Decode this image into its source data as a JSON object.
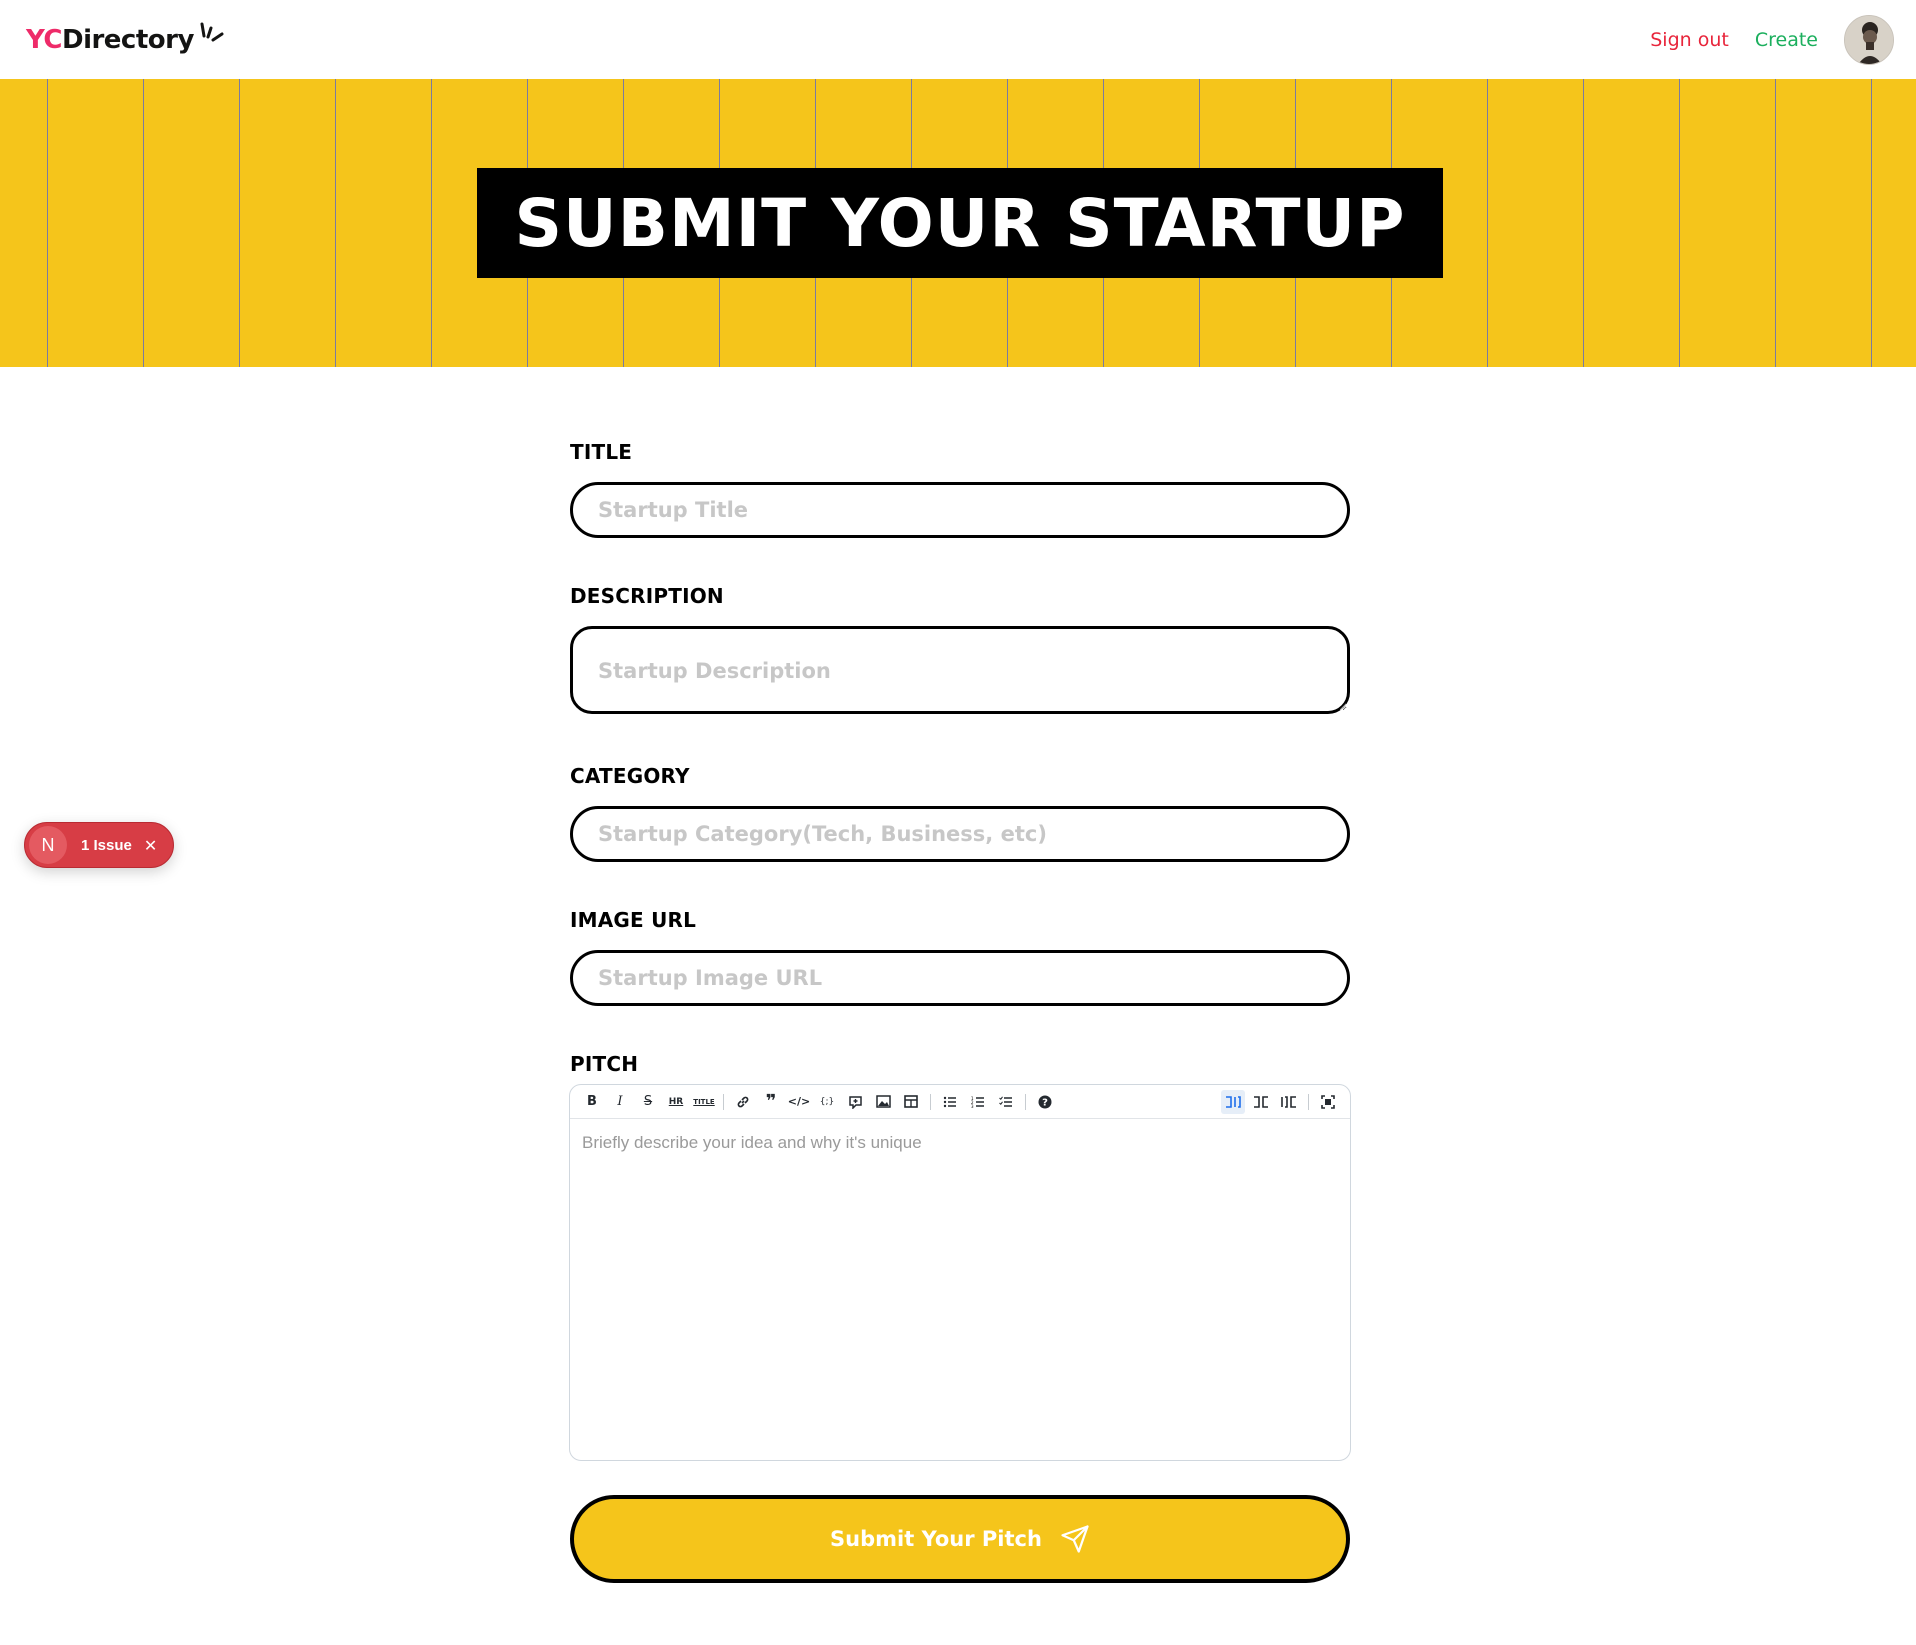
{
  "nav": {
    "logo_prefix": "YC",
    "logo_suffix": "Directory",
    "signout_label": "Sign out",
    "create_label": "Create"
  },
  "hero": {
    "title": "SUBMIT YOUR STARTUP"
  },
  "form": {
    "title": {
      "label": "Title",
      "placeholder": "Startup Title",
      "value": ""
    },
    "description": {
      "label": "Description",
      "placeholder": "Startup Description",
      "value": ""
    },
    "category": {
      "label": "Category",
      "placeholder": "Startup Category(Tech, Business, etc)",
      "value": ""
    },
    "image_url": {
      "label": "Image URL",
      "placeholder": "Startup Image URL",
      "value": ""
    },
    "pitch": {
      "label": "Pitch",
      "placeholder": "Briefly describe your idea and why it's unique",
      "toolbar": {
        "bold": "B",
        "italic": "I",
        "strike": "S",
        "hr": "HR",
        "title": "TITLE",
        "link": "🔗",
        "quote": "❞",
        "code": "</>",
        "codeblock": "{;}",
        "comment": "💬",
        "image": "🖼",
        "table": "▦",
        "ul": "☰",
        "ol": "☷",
        "checklist": "☑",
        "help": "?",
        "edit_mode": "⊐⊏",
        "live_mode": "⊐⊏",
        "preview_mode": "⊏",
        "fullscreen": "⛶"
      }
    },
    "submit_label": "Submit Your Pitch"
  },
  "dev_overlay": {
    "badge_letter": "N",
    "issue_text": "1 Issue",
    "close_glyph": "✕"
  },
  "colors": {
    "primary": "#EE2B69",
    "yellow": "#F5C51B",
    "signout": "#E8253B",
    "create": "#1BAF5D",
    "issue_red": "#D73D45"
  }
}
